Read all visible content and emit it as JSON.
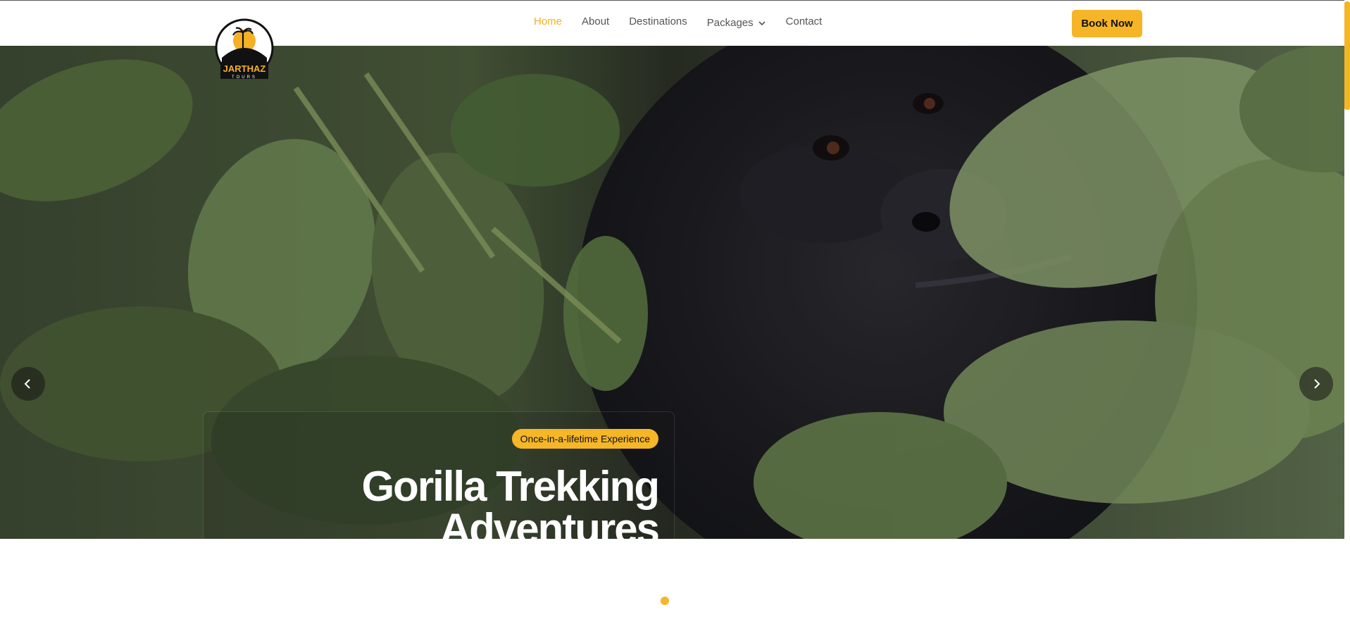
{
  "nav": {
    "items": [
      {
        "label": "Home",
        "active": true
      },
      {
        "label": "About"
      },
      {
        "label": "Destinations"
      },
      {
        "label": "Packages",
        "dropdown": true
      },
      {
        "label": "Contact"
      }
    ],
    "book_label": "Book Now"
  },
  "logo": {
    "brand": "JARTHAZ",
    "sub": "TOURS"
  },
  "hero": {
    "badge": "Once-in-a-lifetime Experience",
    "title_line1": "Gorilla Trekking",
    "title_line2": "Adventures"
  },
  "carousel": {
    "slide_count": 1,
    "active_slide": 1
  },
  "colors": {
    "accent": "#f5b628",
    "nav_text": "#555555",
    "white": "#ffffff"
  },
  "icons": {
    "prev": "chevron-left-icon",
    "next": "chevron-right-icon",
    "dropdown": "chevron-down-icon"
  }
}
